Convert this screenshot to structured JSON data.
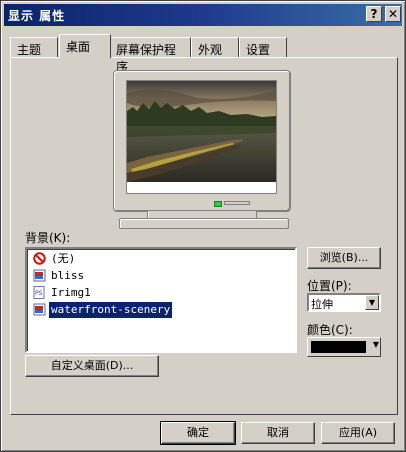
{
  "window": {
    "title": "显示 属性",
    "help_label": "?",
    "close_label": "✕"
  },
  "tabs": [
    {
      "label": "主题"
    },
    {
      "label": "桌面",
      "active": true
    },
    {
      "label": "屏幕保护程序"
    },
    {
      "label": "外观"
    },
    {
      "label": "设置"
    }
  ],
  "preview": {
    "icon": "monitor-preview-icon"
  },
  "background": {
    "label": "背景(K):",
    "items": [
      {
        "label": "(无)",
        "icon": "none-icon"
      },
      {
        "label": "bliss",
        "icon": "image-file-icon"
      },
      {
        "label": "Irimg1",
        "icon": "ps-file-icon"
      },
      {
        "label": "waterfront-scenery",
        "icon": "image-file-icon",
        "selected": true
      }
    ]
  },
  "browse_label": "浏览(B)...",
  "position": {
    "label": "位置(P):",
    "value": "拉伸"
  },
  "color": {
    "label": "颜色(C):",
    "value": "#000000"
  },
  "customize_label": "自定义桌面(D)...",
  "buttons": {
    "ok": "确定",
    "cancel": "取消",
    "apply": "应用(A)"
  }
}
